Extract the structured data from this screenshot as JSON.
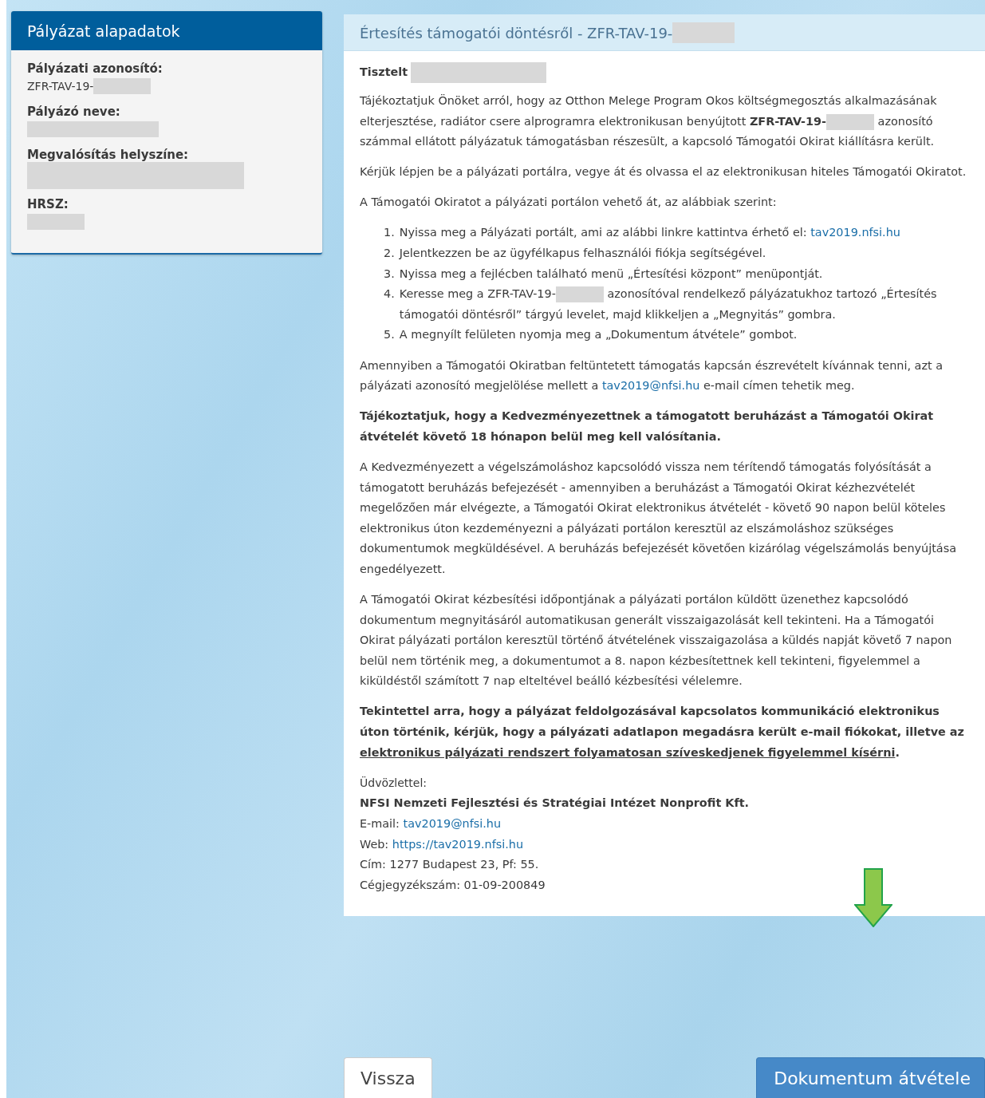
{
  "sidebar": {
    "title": "Pályázat alapadatok",
    "fields": [
      {
        "label": "Pályázati azonosító:",
        "value": [
          {
            "kind": "text",
            "text": "ZFR-TAV-19-"
          },
          {
            "kind": "redacted"
          }
        ]
      },
      {
        "label": "Pályázó neve:",
        "value": [
          {
            "kind": "redacted"
          }
        ]
      },
      {
        "label": "Megvalósítás helyszíne:",
        "value": [
          {
            "kind": "redacted"
          }
        ]
      },
      {
        "label": "HRSZ:",
        "value": [
          {
            "kind": "redacted"
          }
        ]
      }
    ]
  },
  "notice": {
    "title": [
      {
        "kind": "text",
        "text": "Értesítés támogatói döntésről - ZFR-TAV-19-"
      },
      {
        "kind": "redacted"
      }
    ],
    "greeting": [
      {
        "kind": "text",
        "text": "**Tisztelt**"
      },
      {
        "kind": "redacted"
      }
    ],
    "blocks": [
      {
        "kind": "paragraph",
        "bold": false,
        "parts": [
          {
            "kind": "text",
            "text": "Tájékoztatjuk Önöket arról, hogy az Otthon Melege Program Okos költségmegosztás alkalmazásának elterjesztése, radiátor csere alprogramra elektronikusan benyújtott **ZFR-TAV-19-**"
          },
          {
            "kind": "redacted"
          },
          {
            "kind": "text",
            "text": " azonosító számmal ellátott pályázatuk támogatásban részesült, a kapcsoló Támogatói Okirat kiállításra került."
          }
        ]
      },
      {
        "kind": "paragraph",
        "bold": false,
        "parts": [
          {
            "kind": "text",
            "text": "Kérjük lépjen be a pályázati portálra, vegye át és olvassa el az elektronikusan hiteles Támogatói Okiratot."
          }
        ]
      },
      {
        "kind": "paragraph",
        "bold": false,
        "parts": [
          {
            "kind": "text",
            "text": "A Támogatói Okiratot a pályázati portálon vehető át, az alábbiak szerint:"
          }
        ]
      },
      {
        "kind": "list",
        "items": [
          {
            "number": "1.",
            "parts": [
              {
                "kind": "text",
                "text": "Nyissa meg a Pályázati portált, ami az alábbi linkre kattintva érhető el: "
              },
              {
                "kind": "link",
                "text": "tav2019.nfsi.hu"
              }
            ]
          },
          {
            "number": "2.",
            "parts": [
              {
                "kind": "text",
                "text": "Jelentkezzen be az ügyfélkapus felhasználói fiókja segítségével."
              }
            ]
          },
          {
            "number": "3.",
            "parts": [
              {
                "kind": "text",
                "text": "Nyissa meg a fejlécben található menü „Értesítési központ” menüpontját."
              }
            ]
          },
          {
            "number": "4.",
            "parts": [
              {
                "kind": "text",
                "text": "Keresse meg a ZFR-TAV-19-"
              },
              {
                "kind": "redacted"
              },
              {
                "kind": "text",
                "text": " azonosítóval rendelkező pályázatukhoz tartozó „Értesítés támogatói döntésről” tárgyú levelet, majd klikkeljen a „Megnyitás” gombra."
              }
            ]
          },
          {
            "number": "5.",
            "parts": [
              {
                "kind": "text",
                "text": "A megnyílt felületen nyomja meg a „Dokumentum átvétele” gombot."
              }
            ]
          }
        ]
      },
      {
        "kind": "paragraph",
        "bold": false,
        "parts": [
          {
            "kind": "text",
            "text": "Amennyiben a Támogatói Okiratban feltüntetett támogatás kapcsán észrevételt kívánnak tenni, azt a pályázati azonosító megjelölése mellett a "
          },
          {
            "kind": "link",
            "text": "tav2019@nfsi.hu"
          },
          {
            "kind": "text",
            "text": " e-mail címen tehetik meg."
          }
        ]
      },
      {
        "kind": "paragraph",
        "bold": true,
        "parts": [
          {
            "kind": "text",
            "text": "Tájékoztatjuk, hogy a Kedvezményezettnek a támogatott beruházást a Támogatói Okirat átvételét követő 18 hónapon belül meg kell valósítania."
          }
        ]
      },
      {
        "kind": "paragraph",
        "bold": false,
        "parts": [
          {
            "kind": "text",
            "text": "A Kedvezményezett a végelszámoláshoz kapcsolódó vissza nem térítendő támogatás folyósítását a támogatott beruházás befejezését - amennyiben a beruházást a Támogatói Okirat kézhezvételét megelőzően már elvégezte, a Támogatói Okirat elektronikus átvételét - követő 90 napon belül köteles elektronikus úton kezdeményezni a pályázati portálon keresztül az elszámoláshoz szükséges dokumentumok megküldésével. A beruházás befejezését követően kizárólag végelszámolás benyújtása engedélyezett."
          }
        ]
      },
      {
        "kind": "paragraph",
        "bold": false,
        "parts": [
          {
            "kind": "text",
            "text": "A Támogatói Okirat kézbesítési időpontjának a pályázati portálon küldött üzenethez kapcsolódó dokumentum megnyitásáról automatikusan generált visszaigazolását kell tekinteni. Ha a Támogatói Okirat pályázati portálon keresztül történő átvételének visszaigazolása a küldés napját követő 7 napon belül nem történik meg, a dokumentumot a 8. napon kézbesítettnek kell tekinteni, figyelemmel a kiküldéstől számított 7 nap elteltével beálló kézbesítési vélelemre."
          }
        ]
      },
      {
        "kind": "paragraph",
        "bold": true,
        "parts": [
          {
            "kind": "text",
            "text": "Tekintettel arra, hogy a pályázat feldolgozásával kapcsolatos kommunikáció elektronikus úton történik, kérjük, hogy a pályázati adatlapon megadásra került e-mail fiókokat, illetve az "
          },
          {
            "kind": "underline",
            "text": "elektronikus pályázati rendszert folyamatosan szíveskedjenek figyelemmel kísérni"
          },
          {
            "kind": "text",
            "text": "."
          }
        ]
      }
    ],
    "signature": [
      {
        "bold": false,
        "parts": [
          {
            "kind": "text",
            "text": "Üdvözlettel:"
          }
        ]
      },
      {
        "bold": true,
        "parts": [
          {
            "kind": "text",
            "text": "NFSI Nemzeti Fejlesztési és Stratégiai Intézet Nonprofit Kft."
          }
        ]
      },
      {
        "bold": false,
        "parts": [
          {
            "kind": "text",
            "text": "E-mail: "
          },
          {
            "kind": "link",
            "text": "tav2019@nfsi.hu"
          }
        ]
      },
      {
        "bold": false,
        "parts": [
          {
            "kind": "text",
            "text": "Web: "
          },
          {
            "kind": "link",
            "text": "https://tav2019.nfsi.hu"
          }
        ]
      },
      {
        "bold": false,
        "parts": [
          {
            "kind": "text",
            "text": "Cím: 1277 Budapest 23, Pf: 55."
          }
        ]
      },
      {
        "bold": false,
        "parts": [
          {
            "kind": "text",
            "text": "Cégjegyzékszám: 01-09-200849"
          }
        ]
      }
    ]
  },
  "buttons": [
    {
      "kind": "secondary",
      "label": "Vissza"
    },
    {
      "kind": "primary",
      "label": "Dokumentum átvétele"
    }
  ]
}
